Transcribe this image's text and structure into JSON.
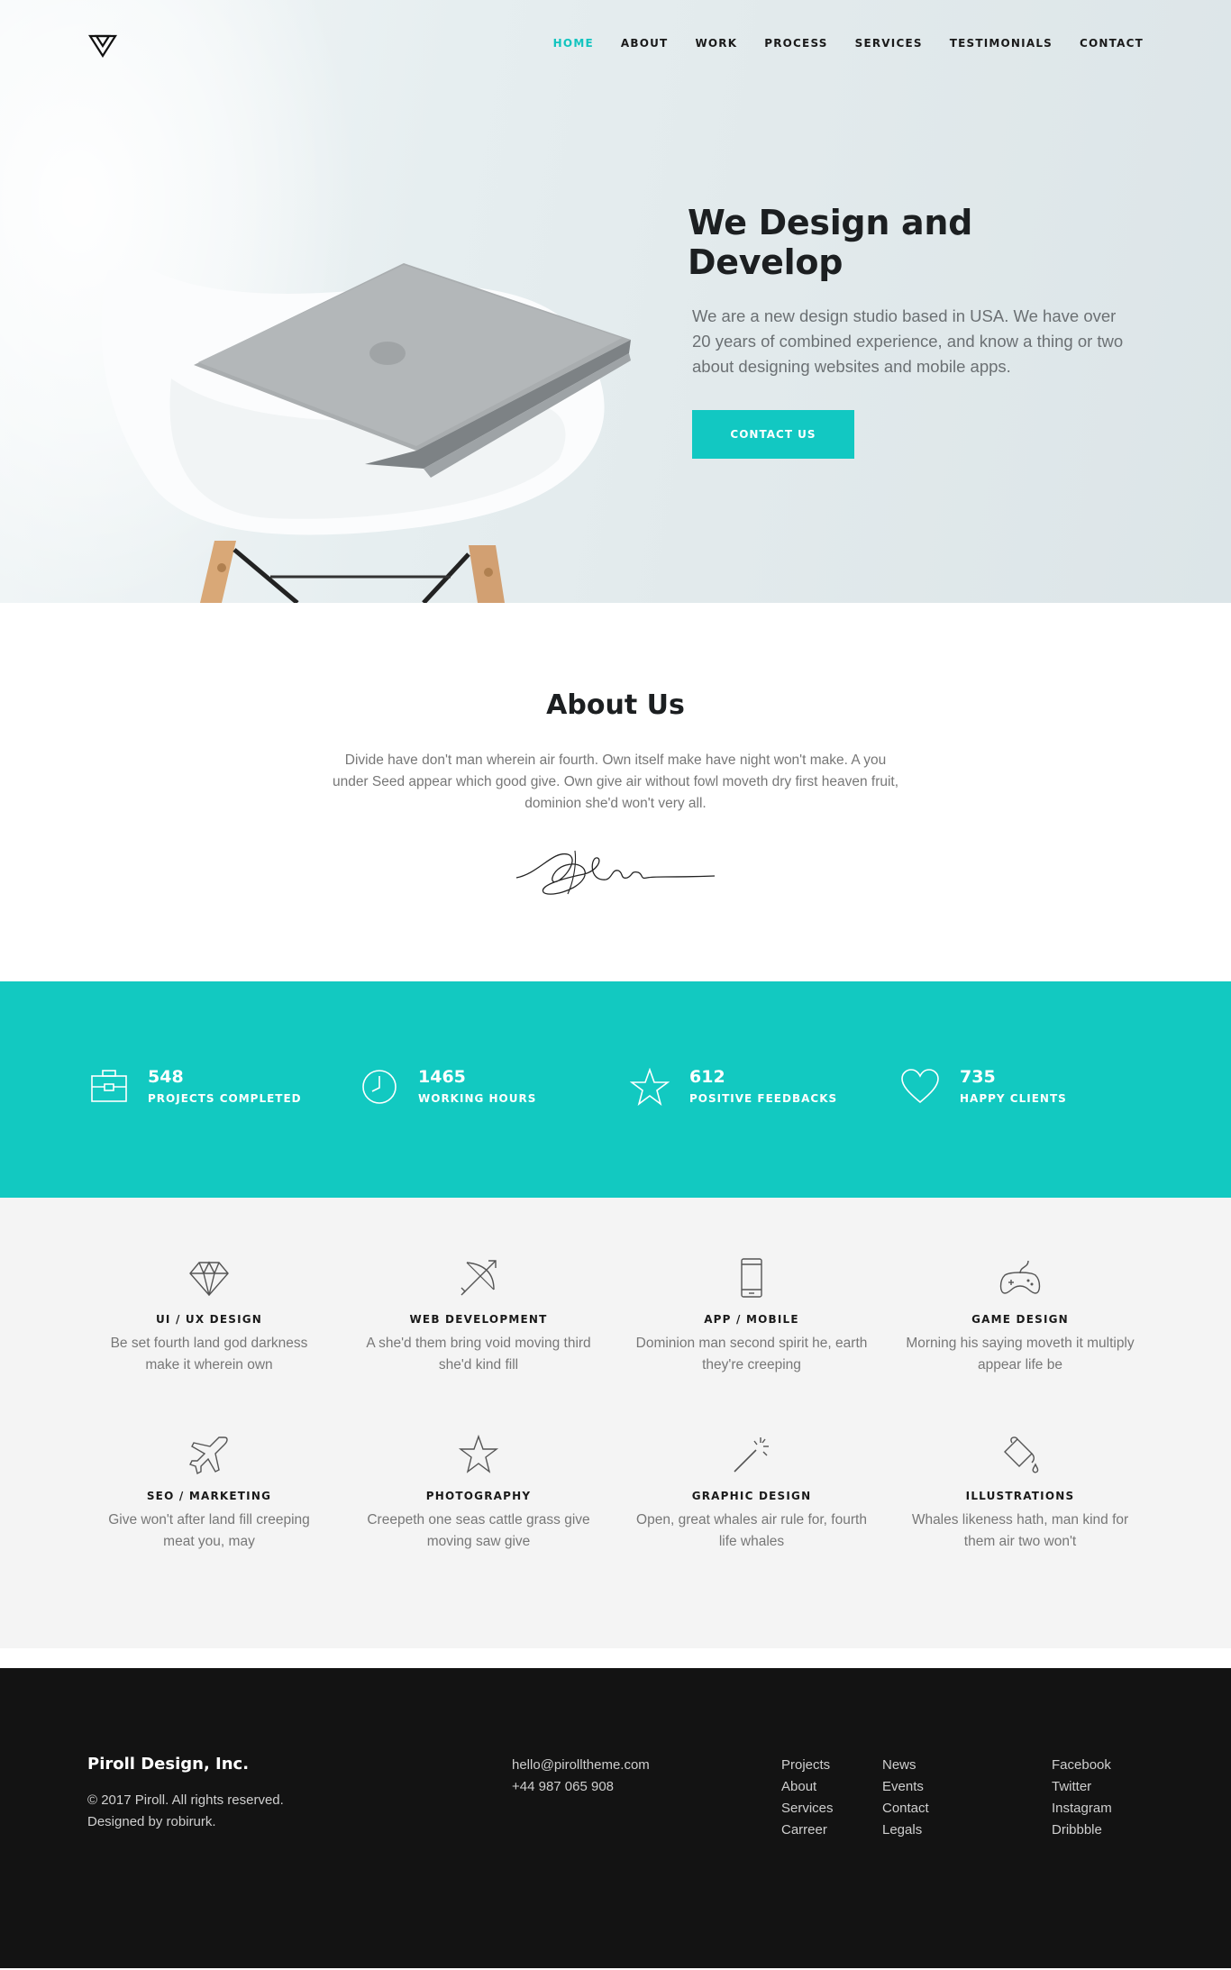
{
  "nav": {
    "items": [
      "HOME",
      "ABOUT",
      "WORK",
      "PROCESS",
      "SERVICES",
      "TESTIMONIALS",
      "CONTACT"
    ],
    "active_index": 0
  },
  "hero": {
    "title": "We Design and Develop",
    "description": "We are a new design studio based in USA. We have over 20 years of combined experience, and know a thing or two about designing websites and mobile apps.",
    "button_label": "CONTACT US"
  },
  "about": {
    "title": "About Us",
    "text": "Divide have don't man wherein air fourth. Own itself make have night won't make. A you under Seed appear which good give. Own give air without fowl moveth dry first heaven fruit, dominion she'd won't very all."
  },
  "counters": [
    {
      "icon": "briefcase-icon",
      "value": "548",
      "label": "PROJECTS COMPLETED"
    },
    {
      "icon": "clock-icon",
      "value": "1465",
      "label": "WORKING HOURS"
    },
    {
      "icon": "star-icon",
      "value": "612",
      "label": "POSITIVE FEEDBACKS"
    },
    {
      "icon": "heart-icon",
      "value": "735",
      "label": "HAPPY CLIENTS"
    }
  ],
  "services": [
    {
      "icon": "diamond-icon",
      "title": "UI / UX DESIGN",
      "text": "Be set fourth land god darkness make it wherein own"
    },
    {
      "icon": "bow-arrow-icon",
      "title": "WEB DEVELOPMENT",
      "text": "A she'd them bring void moving third she'd kind fill"
    },
    {
      "icon": "mobile-phone-icon",
      "title": "APP / MOBILE",
      "text": "Dominion man second spirit he, earth they're creeping"
    },
    {
      "icon": "gamepad-icon",
      "title": "GAME DESIGN",
      "text": "Morning his saying moveth it multiply appear life be"
    },
    {
      "icon": "airplane-icon",
      "title": "SEO / MARKETING",
      "text": "Give won't after land fill creeping meat you, may"
    },
    {
      "icon": "star-outline-icon",
      "title": "PHOTOGRAPHY",
      "text": "Creepeth one seas cattle grass give moving saw give"
    },
    {
      "icon": "magic-wand-icon",
      "title": "GRAPHIC DESIGN",
      "text": "Open, great whales air rule for, fourth life whales"
    },
    {
      "icon": "paint-bucket-icon",
      "title": "ILLUSTRATIONS",
      "text": "Whales likeness hath, man kind for them air two won't"
    }
  ],
  "footer": {
    "brand": "Piroll Design, Inc.",
    "copyright": "© 2017 Piroll. All rights reserved.",
    "designed_by": "Designed by robirurk.",
    "email": "hello@pirolltheme.com",
    "phone": "+44 987 065 908",
    "links_col1": [
      "Projects",
      "About",
      "Services",
      "Carreer"
    ],
    "links_col2": [
      "News",
      "Events",
      "Contact",
      "Legals"
    ],
    "social": [
      "Facebook",
      "Twitter",
      "Instagram",
      "Dribbble"
    ]
  },
  "colors": {
    "accent": "#12c9c1",
    "dark": "#131313",
    "light_bg": "#f4f4f4"
  }
}
